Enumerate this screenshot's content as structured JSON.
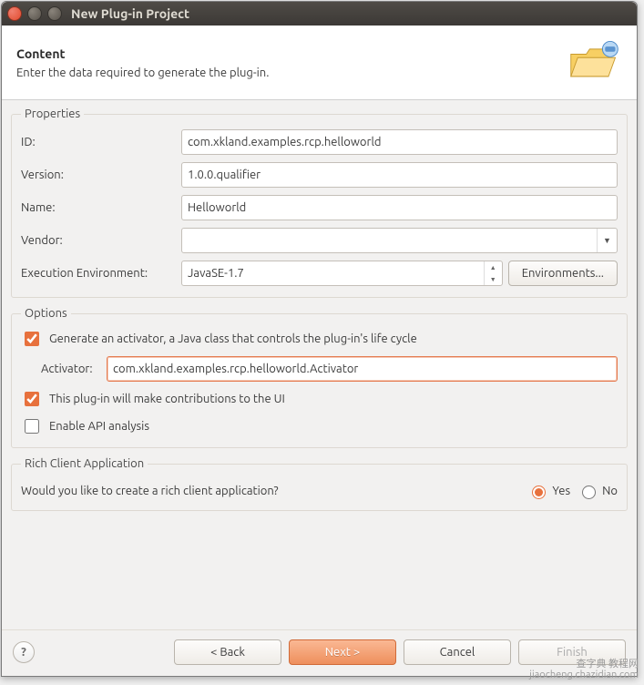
{
  "window": {
    "title": "New Plug-in Project"
  },
  "header": {
    "title": "Content",
    "subtitle": "Enter the data required to generate the plug-in."
  },
  "properties": {
    "legend": "Properties",
    "id_label": "ID:",
    "id_value": "com.xkland.examples.rcp.helloworld",
    "version_label": "Version:",
    "version_value": "1.0.0.qualifier",
    "name_label": "Name:",
    "name_value": "Helloworld",
    "vendor_label": "Vendor:",
    "vendor_value": "",
    "exec_env_label": "Execution Environment:",
    "exec_env_value": "JavaSE-1.7",
    "environments_btn": "Environments..."
  },
  "options": {
    "legend": "Options",
    "gen_activator_label": "Generate an activator, a Java class that controls the plug-in's life cycle",
    "gen_activator_checked": true,
    "activator_label": "Activator:",
    "activator_value": "com.xkland.examples.rcp.helloworld.Activator",
    "contrib_ui_label": "This plug-in will make contributions to the UI",
    "contrib_ui_checked": true,
    "api_analysis_label": "Enable API analysis",
    "api_analysis_checked": false
  },
  "rich": {
    "legend": "Rich Client Application",
    "question": "Would you like to create a rich client application?",
    "yes_label": "Yes",
    "no_label": "No",
    "selected": "yes"
  },
  "buttons": {
    "back": "< Back",
    "next": "Next >",
    "cancel": "Cancel",
    "finish": "Finish"
  },
  "watermark": {
    "line1": "查字典 教程网",
    "line2": "jiaocheng.chazidian.com"
  }
}
